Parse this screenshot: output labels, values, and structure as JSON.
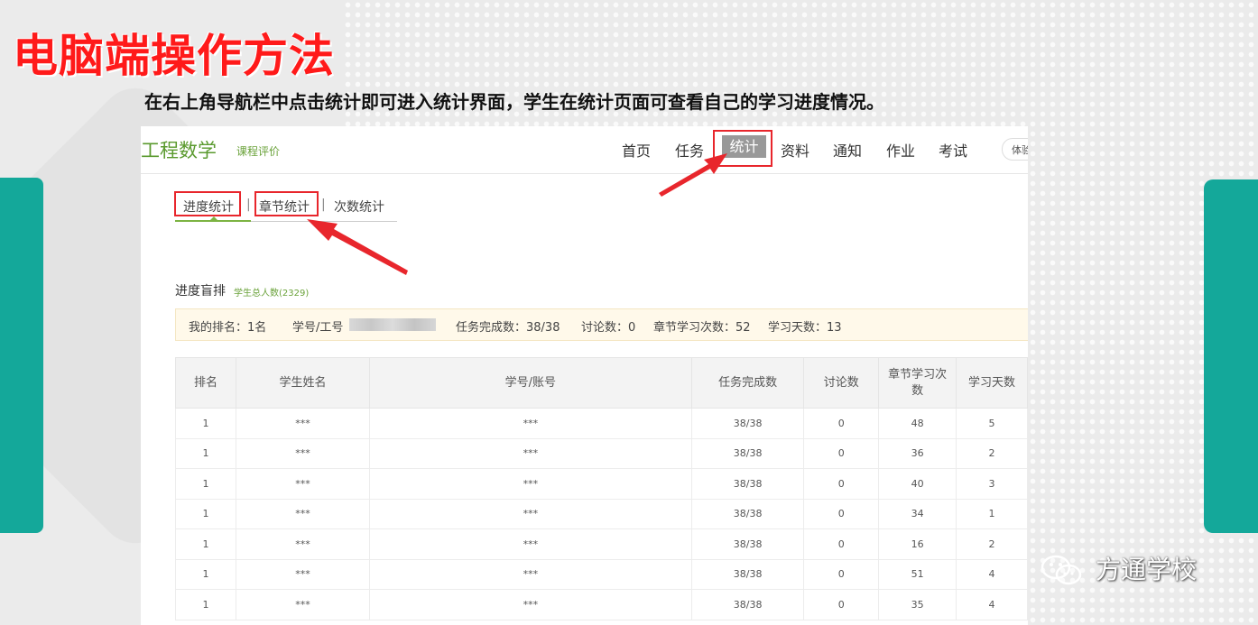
{
  "slide": {
    "title": "电脑端操作方法",
    "instruction": "在右上角导航栏中点击统计即可进入统计界面，学生在统计页面可查看自己的学习进度情况。",
    "watermark": "方通学校",
    "accent_color": "#14a89a",
    "title_color": "#ff1a1a",
    "highlight_color": "#e8262c"
  },
  "header": {
    "course_title": "工程数学",
    "course_eval": "课程评价",
    "nav": [
      "首页",
      "任务",
      "统计",
      "资料",
      "通知",
      "作业",
      "考试"
    ],
    "active_nav": "统计",
    "experience_button": "体验"
  },
  "subtabs": {
    "items": [
      "进度统计",
      "章节统计",
      "次数统计"
    ],
    "separator": "|",
    "active": "进度统计"
  },
  "ranking": {
    "heading": "进度盲排",
    "total_label": "学生总人数(2329)",
    "my_rank": "我的排名：1名",
    "student_id_label": "学号/工号",
    "tasks_done": "任务完成数：38/38",
    "discussions": "讨论数：0",
    "chapter_visits": "章节学习次数：52",
    "study_days": "学习天数：13"
  },
  "table": {
    "columns": [
      "排名",
      "学生姓名",
      "学号/账号",
      "任务完成数",
      "讨论数",
      "章节学习次数",
      "学习天数"
    ],
    "rows": [
      [
        "1",
        "***",
        "***",
        "38/38",
        "0",
        "48",
        "5"
      ],
      [
        "1",
        "***",
        "***",
        "38/38",
        "0",
        "36",
        "2"
      ],
      [
        "1",
        "***",
        "***",
        "38/38",
        "0",
        "40",
        "3"
      ],
      [
        "1",
        "***",
        "***",
        "38/38",
        "0",
        "34",
        "1"
      ],
      [
        "1",
        "***",
        "***",
        "38/38",
        "0",
        "16",
        "2"
      ],
      [
        "1",
        "***",
        "***",
        "38/38",
        "0",
        "51",
        "4"
      ],
      [
        "1",
        "***",
        "***",
        "38/38",
        "0",
        "35",
        "4"
      ]
    ]
  }
}
